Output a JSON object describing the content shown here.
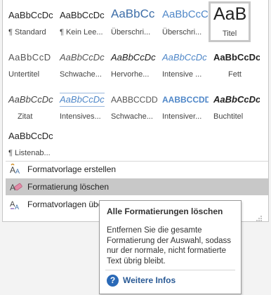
{
  "gallery": {
    "rows": [
      [
        {
          "sample": "AaBbCcDc",
          "name": "¶ Standard"
        },
        {
          "sample": "AaBbCcDc",
          "name": "¶ Kein Lee..."
        },
        {
          "sample": "AaBbCc",
          "name": "Überschri..."
        },
        {
          "sample": "AaBbCcC",
          "name": "Überschri..."
        },
        {
          "sample": "AaB",
          "name": "Titel"
        }
      ],
      [
        {
          "sample": "AaBbCcD",
          "name": "Untertitel"
        },
        {
          "sample": "AaBbCcDc",
          "name": "Schwache..."
        },
        {
          "sample": "AaBbCcDc",
          "name": "Hervorhe..."
        },
        {
          "sample": "AaBbCcDc",
          "name": "Intensive ..."
        },
        {
          "sample": "AaBbCcDc",
          "name": "Fett"
        }
      ],
      [
        {
          "sample": "AaBbCcDc",
          "name": "Zitat"
        },
        {
          "sample": "AaBbCcDc",
          "name": "Intensives..."
        },
        {
          "sample": "AABBCCDD",
          "name": "Schwache..."
        },
        {
          "sample": "AABBCCDD",
          "name": "Intensiver..."
        },
        {
          "sample": "AaBbCcDc",
          "name": "Buchtitel"
        }
      ],
      [
        {
          "sample": "AaBbCcDc",
          "name": "¶ Listenab..."
        }
      ]
    ]
  },
  "menu": {
    "create_style": "Formatvorlage erstellen",
    "clear_formatting": "Formatierung löschen",
    "apply_styles": "Formatvorlagen übe"
  },
  "tooltip": {
    "title": "Alle Formatierungen löschen",
    "body": "Entfernen Sie die gesamte Formatierung der Auswahl, sodass nur der normale, nicht formatierte Text übrig bleibt.",
    "help_link": "Weitere Infos",
    "help_symbol": "?"
  },
  "colors": {
    "accent_blue": "#2a69b7",
    "heading_blue": "#3d6ea8",
    "hover_gray": "#c8c8c8"
  }
}
